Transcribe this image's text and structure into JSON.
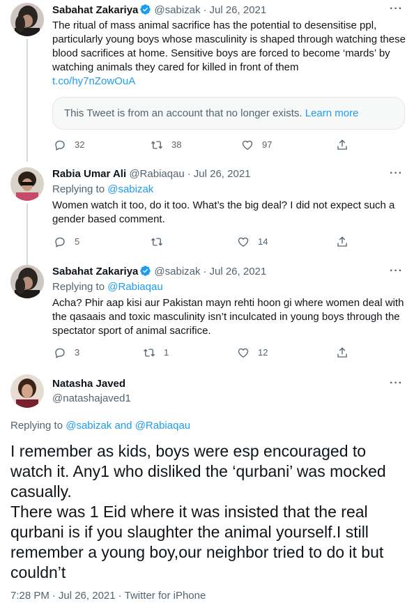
{
  "tweets": [
    {
      "name": "Sabahat Zakariya",
      "handle": "@sabizak",
      "date": "Jul 26, 2021",
      "text": "The ritual of mass animal sacrifice has the potential to desensitise ppl, particularly young boys whose masculinity is shaped through watching these blood sacrifices at home. Sensitive boys are forced to become ‘mards’ by watching animals they cared for killed in front of them",
      "link": "t.co/hy7nZowOuA",
      "notice_text": "This Tweet is from an account that no longer exists.",
      "notice_link": "Learn more",
      "replies": "32",
      "retweets": "38",
      "likes": "97"
    },
    {
      "name": "Rabia Umar Ali",
      "handle": "@Rabiaqau",
      "date": "Jul 26, 2021",
      "replying_prefix": "Replying to",
      "replying_to": "@sabizak",
      "text": "Women watch it too, do it too. What’s the big deal? I did not expect such a gender based comment.",
      "replies": "5",
      "retweets": "",
      "likes": "14"
    },
    {
      "name": "Sabahat Zakariya",
      "handle": "@sabizak",
      "date": "Jul 26, 2021",
      "replying_prefix": "Replying to",
      "replying_to": "@Rabiaqau",
      "text": "Acha? Phir aap kisi aur Pakistan mayn rehti hoon gi where women deal with the qasaais and toxic masculinity isn’t inculcated in young boys through the spectator sport of animal sacrifice.",
      "replies": "3",
      "retweets": "1",
      "likes": "12"
    }
  ],
  "main_tweet": {
    "name": "Natasha Javed",
    "handle": "@natashajaved1",
    "replying_prefix": "Replying to",
    "replying_to_1": "@sabizak",
    "replying_and": "and",
    "replying_to_2": "@Rabiaqau",
    "line1": "I remember as kids, boys were esp encouraged to watch it. Any1 who disliked the ‘qurbani’ was mocked casually.",
    "line2": "There was 1 Eid where it was insisted that the real qurbani is if you slaughter the animal yourself.I still remember a young boy,our neighbor tried to do it but couldn’t",
    "time": "7:28 PM",
    "date": "Jul 26, 2021",
    "source": "Twitter for iPhone"
  },
  "ui": {
    "separator": "·",
    "more_icon": "more-dots-icon",
    "reply_icon": "reply-bubble-icon",
    "retweet_icon": "retweet-icon",
    "like_icon": "heart-icon",
    "share_icon": "share-icon",
    "verified_icon": "verified-badge-icon",
    "accent": "#1d9bf0",
    "text_color": "#0f1419",
    "muted_color": "#536471"
  }
}
